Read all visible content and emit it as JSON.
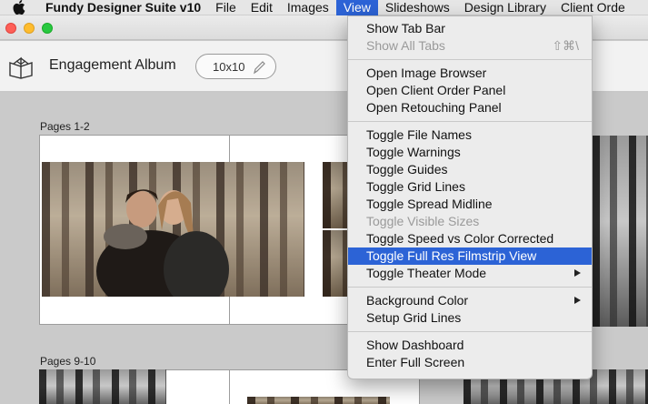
{
  "menubar": {
    "apple_icon": "apple-icon",
    "app_name": "Fundy Designer Suite v10",
    "items": [
      "File",
      "Edit",
      "Images",
      "View",
      "Slideshows",
      "Design Library",
      "Client Orde"
    ],
    "active": "View"
  },
  "toolbar": {
    "album_icon": "book-icon",
    "album_title": "Engagement Album",
    "size_value": "10x10",
    "edit_icon": "pencil-icon"
  },
  "canvas": {
    "sections": [
      {
        "label": "Pages 1-2"
      },
      {
        "label": "Pages 9-10"
      }
    ]
  },
  "view_menu": {
    "groups": [
      [
        {
          "label": "Show Tab Bar",
          "enabled": true
        },
        {
          "label": "Show All Tabs",
          "enabled": false,
          "shortcut": "⇧⌘\\"
        }
      ],
      [
        {
          "label": "Open Image Browser",
          "enabled": true
        },
        {
          "label": "Open Client Order Panel",
          "enabled": true
        },
        {
          "label": "Open Retouching Panel",
          "enabled": true
        }
      ],
      [
        {
          "label": "Toggle File Names",
          "enabled": true
        },
        {
          "label": "Toggle Warnings",
          "enabled": true
        },
        {
          "label": "Toggle Guides",
          "enabled": true
        },
        {
          "label": "Toggle Grid Lines",
          "enabled": true
        },
        {
          "label": "Toggle Spread Midline",
          "enabled": true
        },
        {
          "label": "Toggle Visible Sizes",
          "enabled": false
        },
        {
          "label": "Toggle Speed vs Color Corrected",
          "enabled": true
        },
        {
          "label": "Toggle Full Res Filmstrip View",
          "enabled": true,
          "highlighted": true
        },
        {
          "label": "Toggle Theater Mode",
          "enabled": true,
          "submenu": true
        }
      ],
      [
        {
          "label": "Background Color",
          "enabled": true,
          "submenu": true
        },
        {
          "label": "Setup Grid Lines",
          "enabled": true
        }
      ],
      [
        {
          "label": "Show Dashboard",
          "enabled": true
        },
        {
          "label": "Enter Full Screen",
          "enabled": true
        }
      ]
    ]
  },
  "colors": {
    "accent": "#2c63d6",
    "menubar_bg": "#e6e6e6",
    "canvas_bg": "#cacaca"
  }
}
